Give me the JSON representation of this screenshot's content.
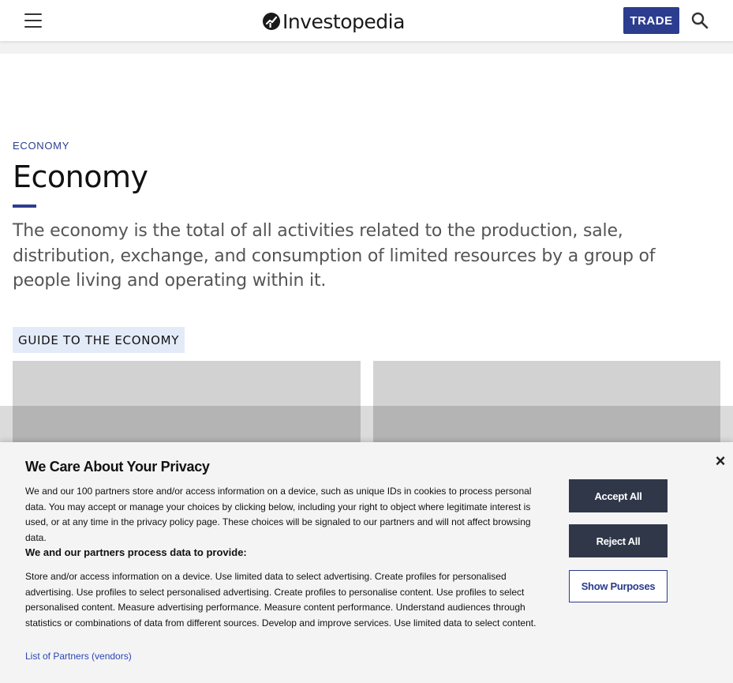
{
  "header": {
    "logo_text": "Investopedia",
    "trade_label": "TRADE"
  },
  "main": {
    "category": "ECONOMY",
    "title": "Economy",
    "intro": "The economy is the total of all activities related to the production, sale, distribution, exchange, and consumption of limited resources by a group of people living and operating within it.",
    "guide_label": "GUIDE TO THE ECONOMY"
  },
  "privacy": {
    "title": "We Care About Your Privacy",
    "paragraph_1": "We and our 100 partners store and/or access information on a device, such as unique IDs in cookies to process personal data. You may accept or manage your choices by clicking below, including your right to object where legitimate interest is used, or at any time in the privacy policy page. These choices will be signaled to our partners and will not affect browsing data.",
    "subheading": "We and our partners process data to provide:",
    "paragraph_2": "Store and/or access information on a device. Use limited data to select advertising. Create profiles for personalised advertising. Use profiles to select personalised advertising. Create profiles to personalise content. Use profiles to select personalised content. Measure advertising performance. Measure content performance. Understand audiences through statistics or combinations of data from different sources. Develop and improve services. Use limited data to select content.",
    "partners_link": "List of Partners (vendors)",
    "accept_label": "Accept All",
    "reject_label": "Reject All",
    "purposes_label": "Show Purposes",
    "close_glyph": "×"
  },
  "colors": {
    "brand_blue": "#2c3d8f",
    "guide_bg": "#e3ebf9",
    "privacy_button": "#2f3749",
    "link": "#2a45b4"
  },
  "icons": {
    "menu": "hamburger-icon",
    "search": "search-icon",
    "logo": "investopedia-logo-icon",
    "close": "close-icon"
  }
}
